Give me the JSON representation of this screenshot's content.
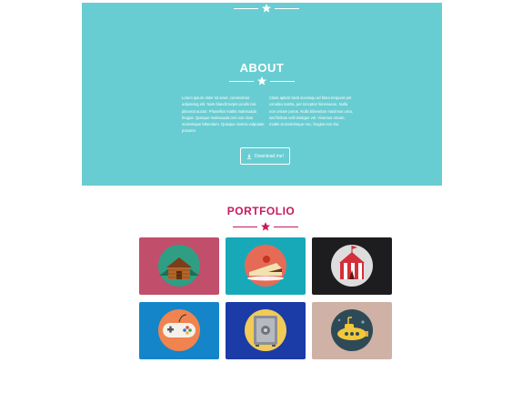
{
  "about": {
    "title": "ABOUT",
    "left_text": "Lorem ipsum dolor sit amet, consectetur adipiscing elit. Nam blandit turpis iaculis nisi placerat auctor. Phasellus mattis malesuada feugiat. Quisque malesuada orci non risus scelerisque bibendum. Quisque viverra vulputate posuere.",
    "right_text": "Class aptent taciti sociosqu ad litora torquent per conubia nostra, per inceptos himenaeos. Nulla non ornare purus. Nulla bibendum maximus urna, sed finibus velit tristique vel. Vivamus ornare, mattis at scelerisque nec, feugiat non dui.",
    "download_label": "Download me!",
    "accent_color": "#68cdd2"
  },
  "portfolio": {
    "title": "PORTFOLIO",
    "accent_color": "#c8195a",
    "items": [
      {
        "name": "cabin",
        "icon": "cabin-icon",
        "bg": "#c14e6b",
        "circle": "#2f9e83"
      },
      {
        "name": "cake",
        "icon": "cake-icon",
        "bg": "#18a9b9",
        "circle": "#e66b57"
      },
      {
        "name": "circus",
        "icon": "circus-tent-icon",
        "bg": "#1d1d1f",
        "circle": "#dddddd"
      },
      {
        "name": "game",
        "icon": "gamepad-icon",
        "bg": "#1485c8",
        "circle": "#f0834e"
      },
      {
        "name": "safe",
        "icon": "safe-icon",
        "bg": "#1b3ba7",
        "circle": "#f0cb58"
      },
      {
        "name": "submarine",
        "icon": "submarine-icon",
        "bg": "#cfb1a5",
        "circle": "#2d4a56"
      }
    ]
  }
}
